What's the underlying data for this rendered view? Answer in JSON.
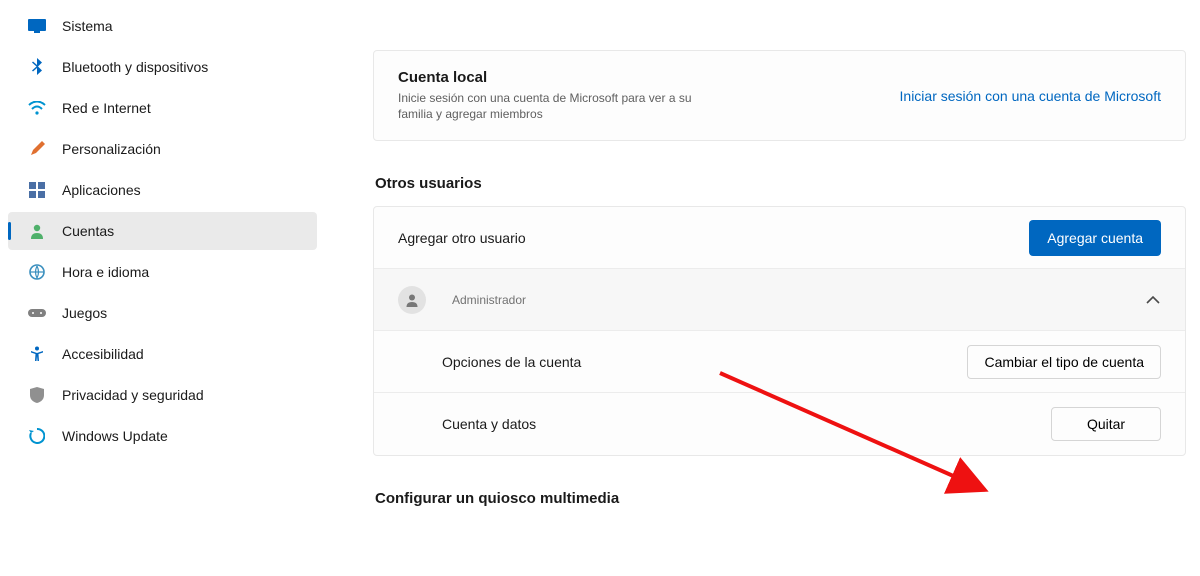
{
  "sidebar": {
    "items": [
      {
        "label": "Sistema",
        "icon": "display"
      },
      {
        "label": "Bluetooth y dispositivos",
        "icon": "bluetooth"
      },
      {
        "label": "Red e Internet",
        "icon": "wifi"
      },
      {
        "label": "Personalización",
        "icon": "brush"
      },
      {
        "label": "Aplicaciones",
        "icon": "apps"
      },
      {
        "label": "Cuentas",
        "icon": "person",
        "active": true
      },
      {
        "label": "Hora e idioma",
        "icon": "globe-clock"
      },
      {
        "label": "Juegos",
        "icon": "gamepad"
      },
      {
        "label": "Accesibilidad",
        "icon": "accessibility"
      },
      {
        "label": "Privacidad y seguridad",
        "icon": "shield"
      },
      {
        "label": "Windows Update",
        "icon": "update"
      }
    ]
  },
  "local_account": {
    "title": "Cuenta local",
    "subtitle": "Inicie sesión con una cuenta de Microsoft para ver a su familia y agregar miembros",
    "link": "Iniciar sesión con una cuenta de Microsoft"
  },
  "other_users": {
    "title": "Otros usuarios",
    "add_label": "Agregar otro usuario",
    "add_button": "Agregar cuenta",
    "user_role": "Administrador",
    "options_label": "Opciones de la cuenta",
    "options_button": "Cambiar el tipo de cuenta",
    "data_label": "Cuenta y datos",
    "remove_button": "Quitar"
  },
  "kiosk": {
    "title": "Configurar un quiosco multimedia"
  },
  "colors": {
    "accent": "#0067c0"
  }
}
